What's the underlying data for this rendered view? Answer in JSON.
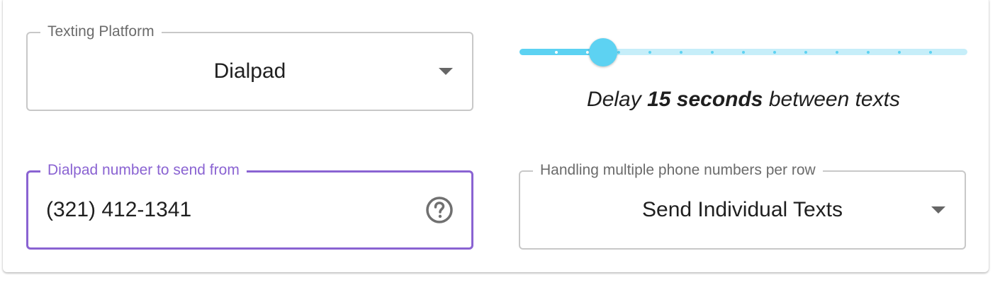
{
  "platform_select": {
    "label": "Texting Platform",
    "value": "Dialpad"
  },
  "delay_slider": {
    "value_seconds": 15,
    "min_seconds": 0,
    "max_seconds": 120,
    "step_seconds": 10,
    "text_prefix": "Delay",
    "text_bold": "15 seconds",
    "text_suffix": "between texts"
  },
  "from_number_field": {
    "label": "Dialpad number to send from",
    "value": "(321) 412-1341",
    "help_icon": "question-circle-icon"
  },
  "multiple_numbers_select": {
    "label": "Handling multiple phone numbers per row",
    "value": "Send Individual Texts"
  },
  "colors": {
    "accent_purple": "#8a63d2",
    "slider_blue": "#5dd2f2",
    "slider_rail": "#c6eef9",
    "text": "#1f1f1f",
    "label_gray": "#6b6b6b",
    "border_gray": "#c8c8c8"
  }
}
